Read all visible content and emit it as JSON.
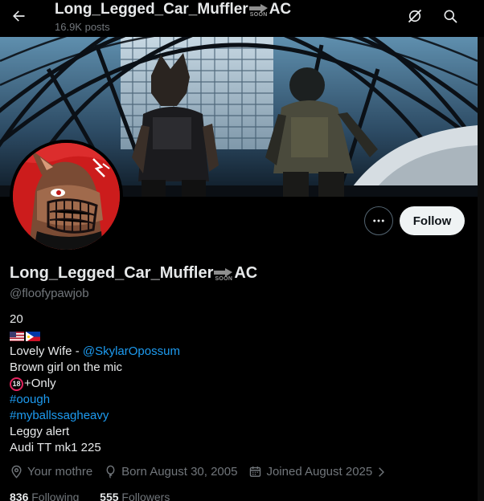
{
  "header": {
    "title_main": "Long_Legged_Car_Muffler",
    "title_soon": "SOON",
    "title_tail": "AC",
    "posts_count": "16.9K posts"
  },
  "actions": {
    "follow_label": "Follow"
  },
  "profile": {
    "name_main": "Long_Legged_Car_Muffler",
    "name_soon": "SOON",
    "name_tail": "AC",
    "handle": "@floofypawjob"
  },
  "bio": {
    "line_age": "20",
    "wife_prefix": "Lovely Wife - ",
    "wife_link": "@SkylarOpossum",
    "line_mic": "Brown girl on the mic",
    "badge18": "18",
    "line_only": "+Only",
    "hashtag_1": "#oough",
    "hashtag_2": "#myballssagheavy",
    "line_alert": "Leggy alert",
    "line_car": "Audi TT mk1 225"
  },
  "meta": {
    "location": "Your mothre",
    "born": "Born August 30, 2005",
    "joined": "Joined August 2025"
  },
  "stats": {
    "following_count": "836",
    "following_label": "Following",
    "followers_count": "555",
    "followers_label": "Followers"
  },
  "icons": {
    "back": "arrow-left-icon",
    "grok": "grok-icon",
    "search": "search-icon",
    "more": "more-dots-icon",
    "location": "location-pin-icon",
    "birthday": "balloon-icon",
    "calendar": "calendar-icon",
    "chevron": "chevron-right-icon"
  },
  "colors": {
    "accent_link": "#1d9bf0",
    "muted_text": "#71767b",
    "follow_bg": "#eff3f4"
  }
}
